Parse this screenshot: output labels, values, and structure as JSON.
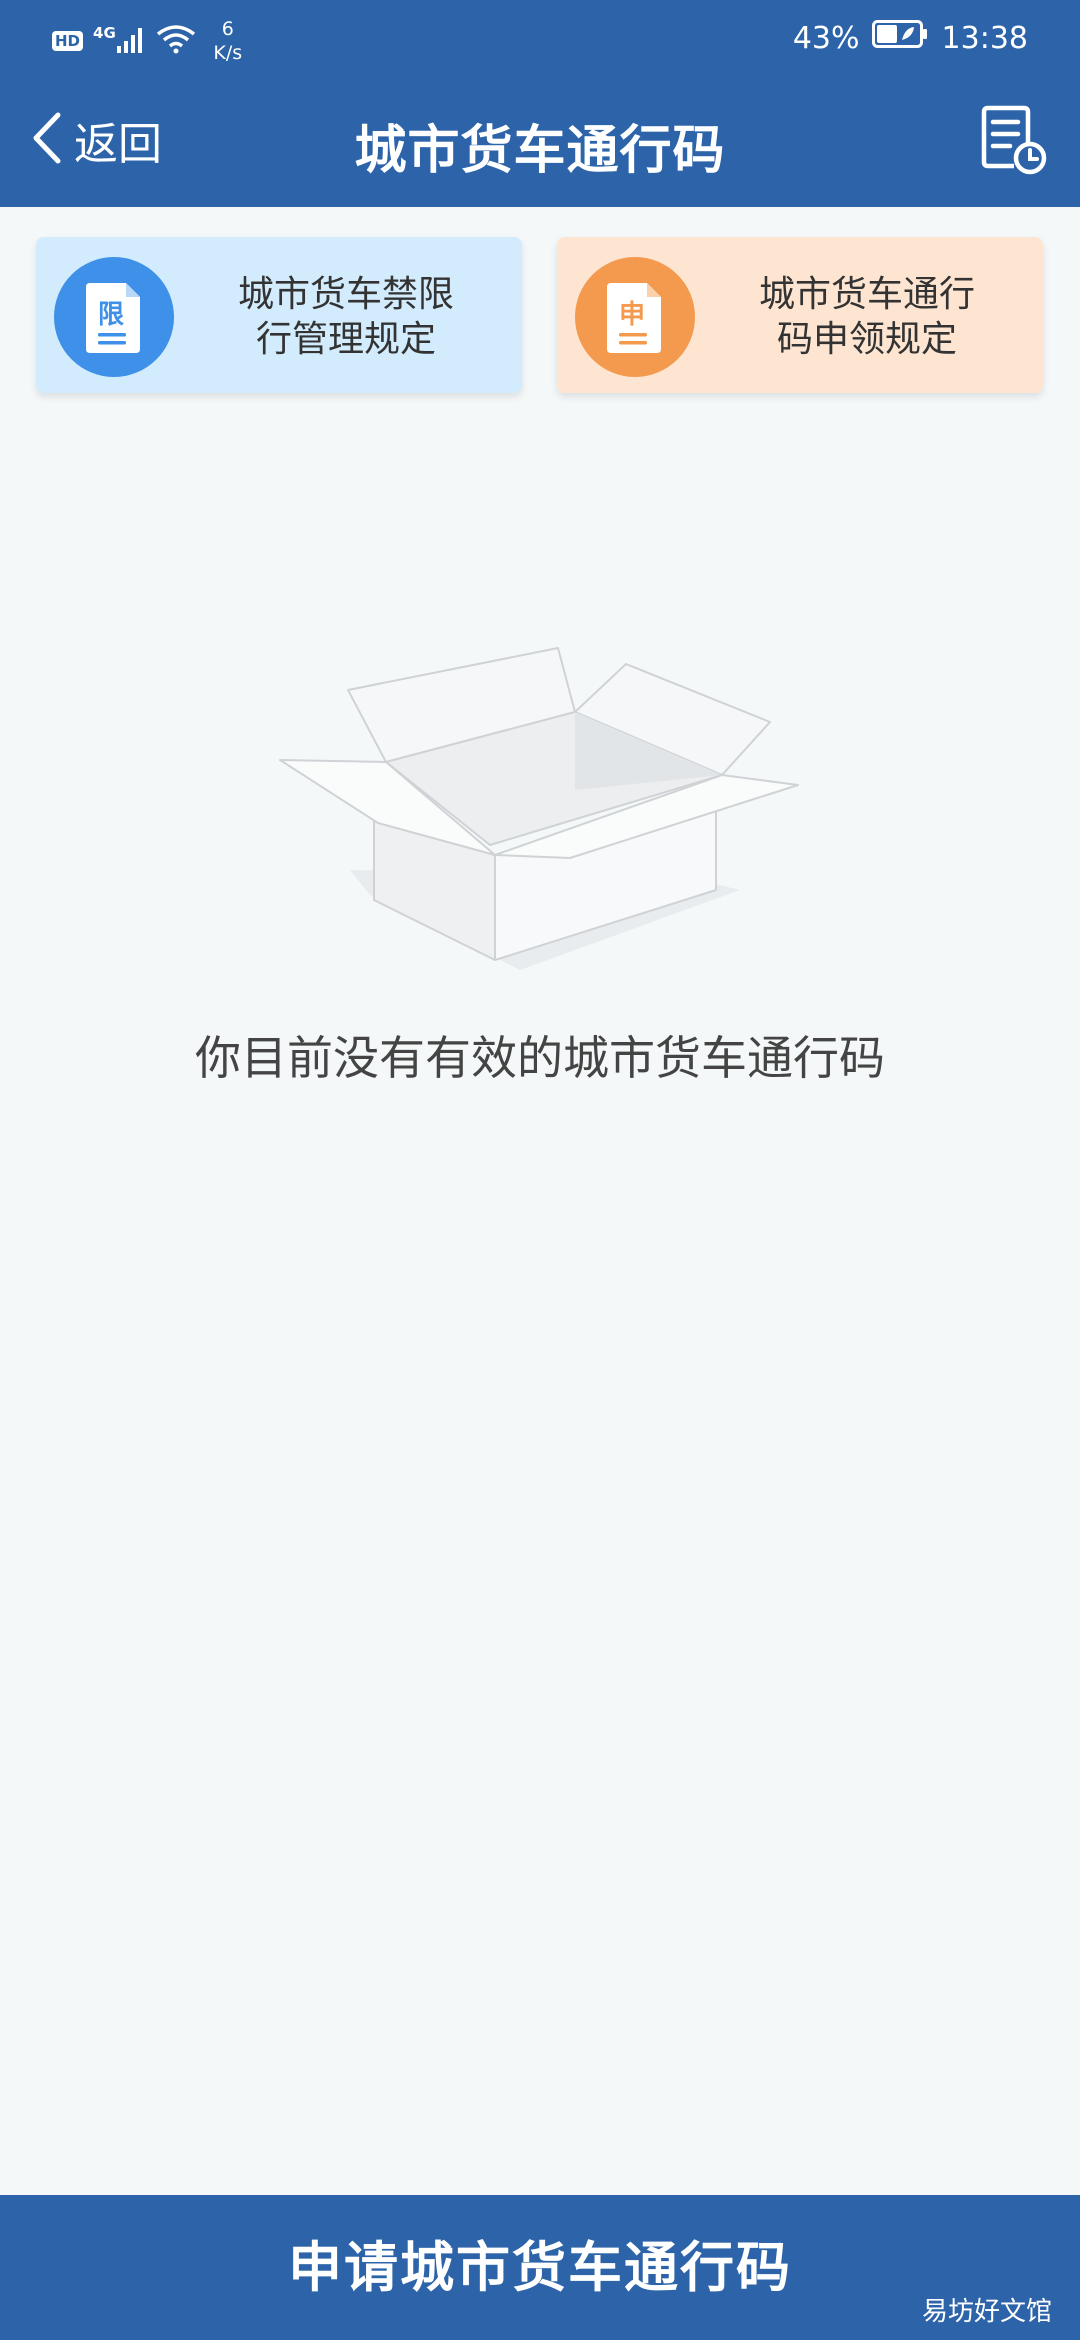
{
  "status_bar": {
    "hd": "HD",
    "network_type": "4G",
    "speed_value": "6",
    "speed_unit": "K/s",
    "battery_percent": "43%",
    "time": "13:38",
    "icons": [
      "signal-icon",
      "wifi-icon",
      "battery-icon"
    ]
  },
  "nav": {
    "back_label": "返回",
    "title": "城市货车通行码",
    "back_icon": "chevron-left-icon",
    "history_icon": "document-clock-icon"
  },
  "cards": [
    {
      "badge": "限",
      "label_line1": "城市货车禁限",
      "label_line2": "行管理规定",
      "icon_color": "#3e90e9",
      "background": "#d3ecfd"
    },
    {
      "badge": "申",
      "label_line1": "城市货车通行",
      "label_line2": "码申领规定",
      "icon_color": "#f39a4e",
      "background": "#fde5d1"
    }
  ],
  "empty_state": {
    "illustration": "empty-box-icon",
    "message": "你目前没有有效的城市货车通行码"
  },
  "apply_button": {
    "label": "申请城市货车通行码"
  },
  "watermark": "易坊好文馆",
  "colors": {
    "primary": "#2d64a9",
    "background": "#f4f8f9"
  }
}
